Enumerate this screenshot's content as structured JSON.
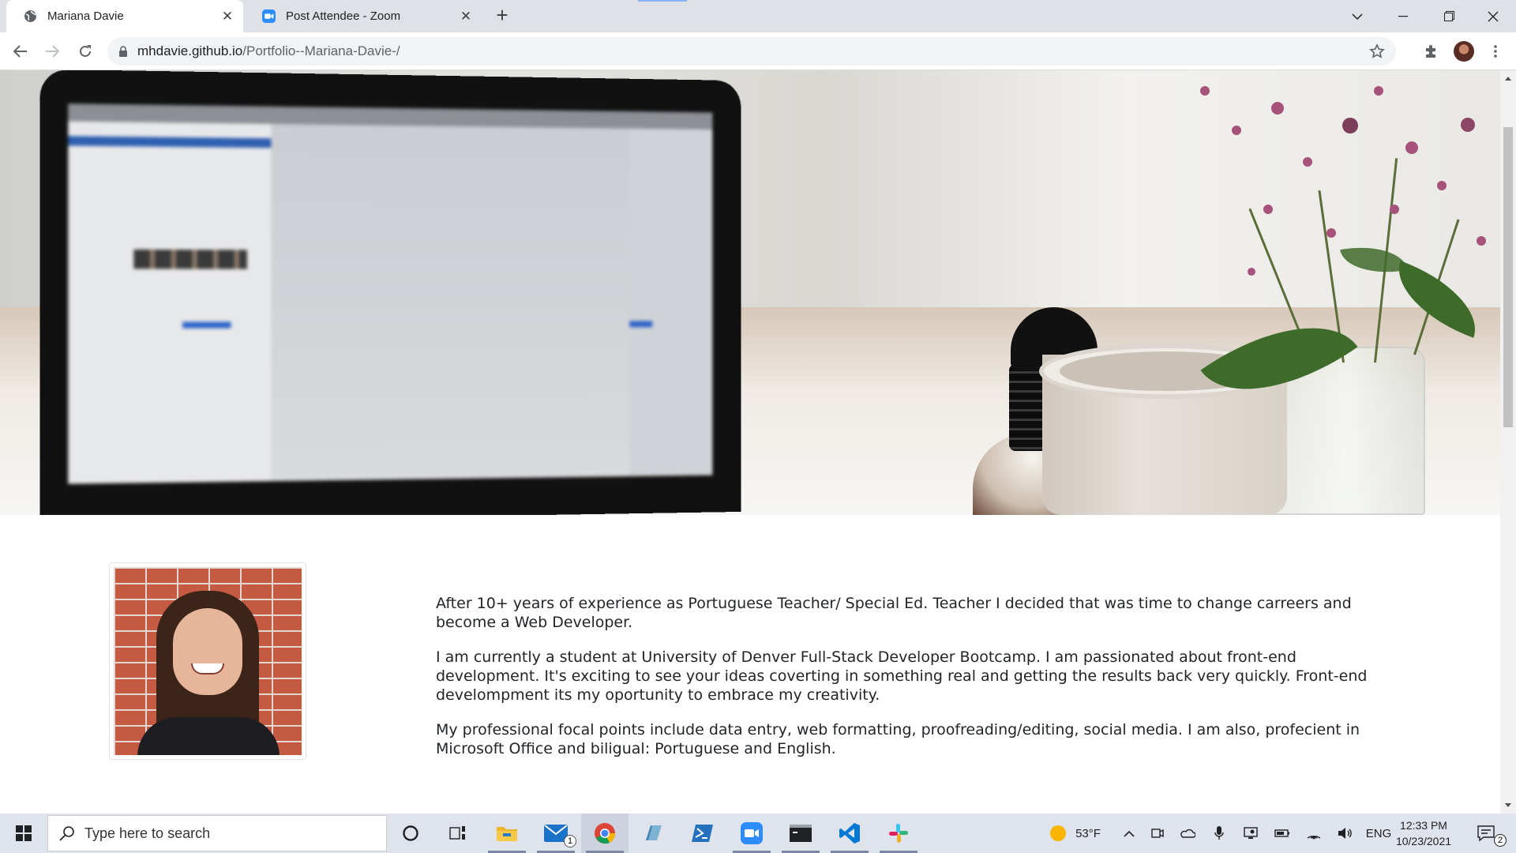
{
  "browser": {
    "tabs": [
      {
        "title": "Mariana Davie",
        "active": true
      },
      {
        "title": "Post Attendee - Zoom",
        "active": false
      }
    ],
    "url_host": "mhdavie.github.io",
    "url_path": "/Portfolio--Mariana-Davie-/",
    "accent_color": "#8ab4f8"
  },
  "page": {
    "bio_paragraphs": [
      "After 10+ years of experience as Portuguese Teacher/ Special Ed. Teacher I decided that was time to change carreers and become a Web Developer.",
      "I am currently a student at University of Denver Full-Stack Developer Bootcamp. I am passionated about front-end development. It's exciting to see your ideas coverting in something real and getting the results back very quickly. Front-end develompment its my oportunity to embrace my creativity.",
      "My professional focal points include data entry, web formatting, proofreading/editing, social media. I am also, profecient in Microsoft Office and biligual: Portuguese and English."
    ]
  },
  "taskbar": {
    "search_placeholder": "Type here to search",
    "mail_badge": "1",
    "weather": "53°F",
    "language": "ENG",
    "time": "12:33 PM",
    "date": "10/23/2021",
    "notifications_count": "2"
  }
}
